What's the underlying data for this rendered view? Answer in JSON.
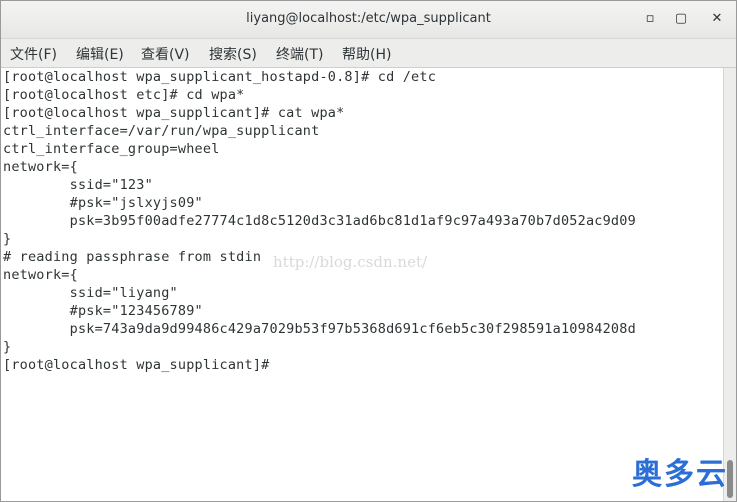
{
  "window": {
    "title": "liyang@localhost:/etc/wpa_supplicant",
    "minimize_glyph": "▫",
    "maximize_glyph": "▢",
    "close_glyph": "✕"
  },
  "menu": [
    {
      "label": "文件(F)"
    },
    {
      "label": "编辑(E)"
    },
    {
      "label": "查看(V)"
    },
    {
      "label": "搜索(S)"
    },
    {
      "label": "终端(T)"
    },
    {
      "label": "帮助(H)"
    }
  ],
  "terminal": {
    "lines": [
      "[root@localhost wpa_supplicant_hostapd-0.8]# cd /etc",
      "[root@localhost etc]# cd wpa*",
      "[root@localhost wpa_supplicant]# cat wpa*",
      "ctrl_interface=/var/run/wpa_supplicant",
      "ctrl_interface_group=wheel",
      "network={",
      "        ssid=\"123\"",
      "        #psk=\"jslxyjs09\"",
      "        psk=3b95f00adfe27774c1d8c5120d3c31ad6bc81d1af9c97a493a70b7d052ac9d09",
      "}",
      "# reading passphrase from stdin",
      "network={",
      "        ssid=\"liyang\"",
      "        #psk=\"123456789\"",
      "        psk=743a9da9d99486c429a7029b53f97b5368d691cf6eb5c30f298591a10984208d",
      "}",
      "[root@localhost wpa_supplicant]# "
    ]
  },
  "watermark": "http://blog.csdn.net/",
  "brand": "奥多云"
}
